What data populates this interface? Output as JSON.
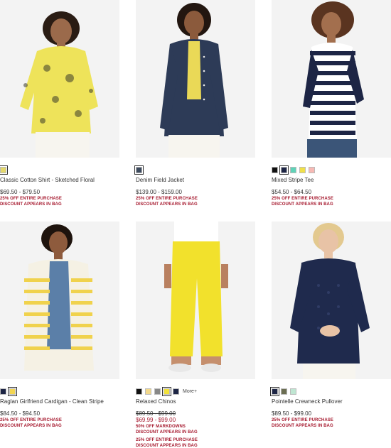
{
  "products": [
    {
      "name": "Classic Cotton Shirt - Sketched Floral",
      "price": "$69.50 - $79.50",
      "promo1": "25% OFF ENTIRE PURCHASE",
      "promo2": "DISCOUNT APPEARS IN BAG",
      "swatches": [
        "#e4d86a"
      ]
    },
    {
      "name": "Denim Field Jacket",
      "price": "$139.00 - $159.00",
      "promo1": "25% OFF ENTIRE PURCHASE",
      "promo2": "DISCOUNT APPEARS IN BAG",
      "swatches": [
        "#3c4a5e"
      ]
    },
    {
      "name": "Mixed Stripe Tee",
      "price": "$54.50 - $64.50",
      "promo1": "25% OFF ENTIRE PURCHASE",
      "promo2": "DISCOUNT APPEARS IN BAG",
      "swatches": [
        "#111111",
        "#1d2545",
        "#5fd3b8",
        "#f0e04a",
        "#f7b9b4"
      ]
    },
    {
      "name": "Raglan Girlfriend Cardigan - Clean Stripe",
      "price": "$84.50 - $94.50",
      "promo1": "25% OFF ENTIRE PURCHASE",
      "promo2": "DISCOUNT APPEARS IN BAG",
      "swatches": [
        "#1d2545",
        "#f2d552"
      ]
    },
    {
      "name": "Relaxed Chinos",
      "price_original": "$89.50 - $99.00",
      "price_sale": "$69.99 - $99.00",
      "promo0": "50% OFF MARKDOWNS",
      "promo0b": "DISCOUNT APPEARS IN BAG",
      "promo1": "25% OFF ENTIRE PURCHASE",
      "promo2": "DISCOUNT APPEARS IN BAG",
      "swatches": [
        "#111111",
        "#f3d98c",
        "#888888",
        "#f2e23a",
        "#1d2545"
      ],
      "more": "More+"
    },
    {
      "name": "Pointelle Crewneck Pullover",
      "price": "$89.50 - $99.00",
      "promo1": "25% OFF ENTIRE PURCHASE",
      "promo2": "DISCOUNT APPEARS IN BAG",
      "swatches": [
        "#1d2545",
        "#6b6e52",
        "#bfe6d2"
      ]
    }
  ]
}
